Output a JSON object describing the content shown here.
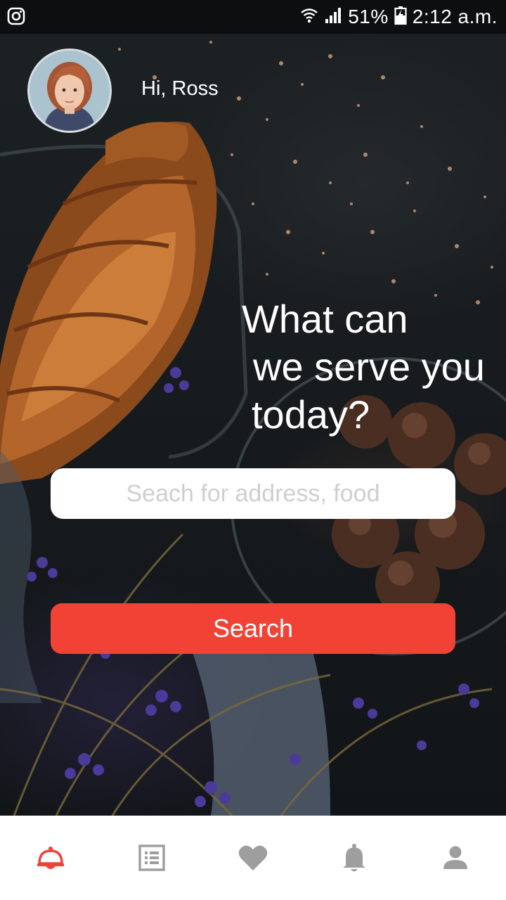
{
  "status_bar": {
    "left_icon": "instagram-icon",
    "battery_percent": "51%",
    "time": "2:12 a.m."
  },
  "header": {
    "avatar_icon": "user-avatar",
    "greeting": "Hi, Ross"
  },
  "hero": {
    "title_lines": [
      "What can",
      "we serve you",
      "today?"
    ]
  },
  "search": {
    "placeholder": "Seach for address, food",
    "value": "",
    "button_label": "Search"
  },
  "bottom_nav": {
    "active_color": "#f24236",
    "inactive_color": "#9e9e9e",
    "items": [
      {
        "icon": "cloche-icon",
        "active": true
      },
      {
        "icon": "menu-list-icon",
        "active": false
      },
      {
        "icon": "heart-icon",
        "active": false
      },
      {
        "icon": "bell-icon",
        "active": false
      },
      {
        "icon": "profile-icon",
        "active": false
      }
    ]
  },
  "colors": {
    "accent": "#f24236",
    "nav_background": "#ffffff"
  }
}
